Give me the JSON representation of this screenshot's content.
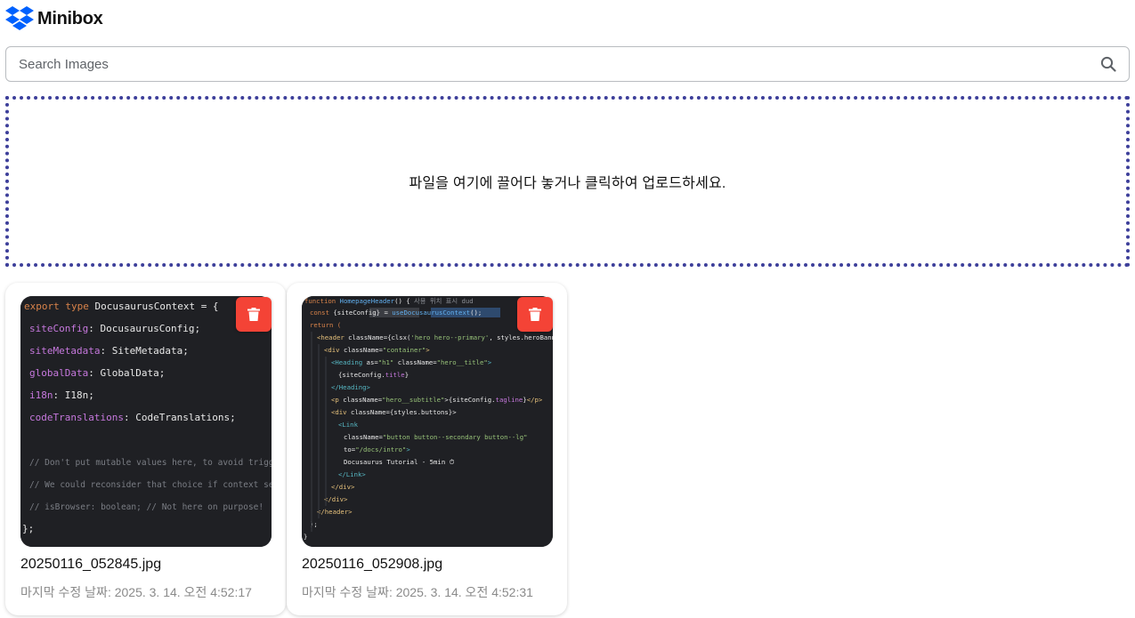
{
  "app": {
    "title": "Minibox",
    "logo_icon": "dropbox-logo-icon",
    "brand_color": "#0061fe"
  },
  "search": {
    "placeholder": "Search Images",
    "value": "",
    "icon": "search-icon"
  },
  "dropzone": {
    "text": "파일을 여기에 끌어다 놓거나 클릭하여 업로드하세요.",
    "border_color": "#3d3f9a"
  },
  "delete_color": "#f44336",
  "images": [
    {
      "file_name": "20250116_052845.jpg",
      "modified": "마지막 수정 날짜: 2025. 3. 14. 오전 4:52:17",
      "code_lines": [
        "export type DocusaurusContext = {",
        "  siteConfig: DocusaurusConfig;",
        "  siteMetadata: SiteMetadata;",
        "  globalData: GlobalData;",
        "  i18n: I18n;",
        "  codeTranslations: CodeTranslations;",
        "",
        "  // Don't put mutable values here, to avoid triggering re-renders",
        "  // We could reconsider that choice if context selectors are implemented",
        "  // isBrowser: boolean; // Not here on purpose!",
        "};"
      ]
    },
    {
      "file_name": "20250116_052908.jpg",
      "modified": "마지막 수정 날짜: 2025. 3. 14. 오전 4:52:31",
      "code_lines": [
        "function HomepageHeader() {  사용 위치 표시  dud",
        "  const {siteConfig} = useDocusaurusContext();",
        "  return (",
        "    <header className={clsx('hero hero--primary', styles.heroBanner)}>",
        "      <div className=\"container\">",
        "        <Heading as=\"h1\" className=\"hero__title\">",
        "          {siteConfig.title}",
        "        </Heading>",
        "        <p className=\"hero__subtitle\">{siteConfig.tagline}</p>",
        "        <div className={styles.buttons}>",
        "          <Link",
        "            className=\"button button--secondary button--lg\"",
        "            to=\"/docs/intro\">",
        "            Docusaurus Tutorial - 5min ⏱",
        "          </Link>",
        "        </div>",
        "      </div>",
        "    </header>",
        "  );",
        "}"
      ]
    }
  ]
}
